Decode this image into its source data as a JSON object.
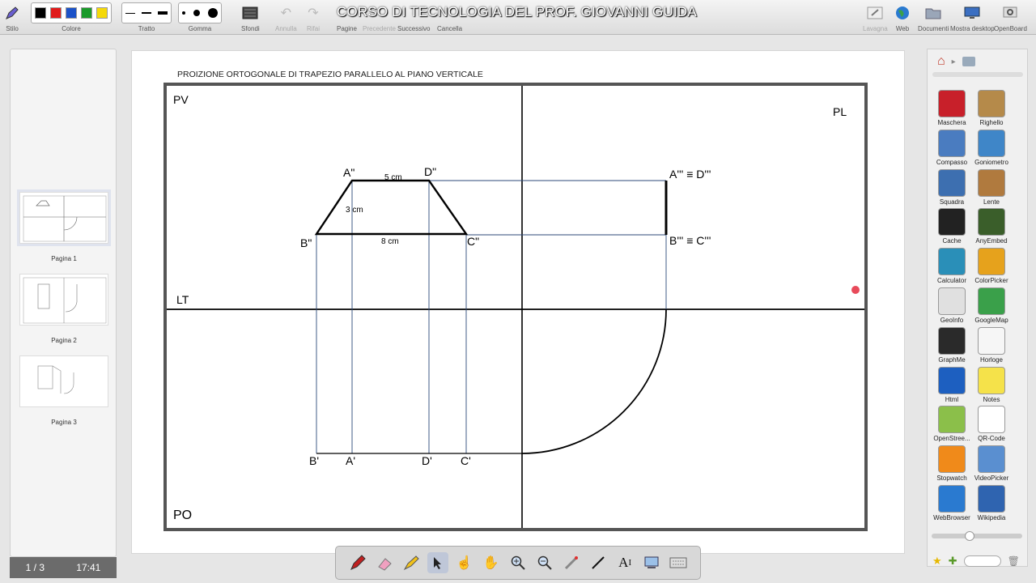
{
  "window_title": "CORSO DI TECNOLOGIA DEL PROF. GIOVANNI GUIDA",
  "toolbar": {
    "stilo": "Stilo",
    "colore": "Colore",
    "tratto": "Tratto",
    "gomma": "Gomma",
    "sfondi": "Sfondi",
    "annulla": "Annulla",
    "rifai": "Rifai",
    "pagine": "Pagine",
    "precedente": "Precedente",
    "successivo": "Successivo",
    "cancella": "Cancella",
    "lavagna": "Lavagna",
    "web": "Web",
    "documenti": "Documenti",
    "mostra_desktop": "Mostra desktop",
    "openboard": "OpenBoard",
    "colors": [
      "#000000",
      "#e01b1b",
      "#1b52c8",
      "#1a9a2a",
      "#f5d90a"
    ]
  },
  "pages": [
    {
      "label": "Pagina 1"
    },
    {
      "label": "Pagina 2"
    },
    {
      "label": "Pagina 3"
    }
  ],
  "status": {
    "page_counter": "1 / 3",
    "time": "17:41"
  },
  "drawing": {
    "title": "PROIZIONE ORTOGONALE DI TRAPEZIO PARALLELO AL PIANO VERTICALE",
    "pv": "PV",
    "pl": "PL",
    "lt": "LT",
    "po": "PO",
    "a2": "A\"",
    "d2": "D\"",
    "b2": "B\"",
    "c2": "C\"",
    "a3d3": "A''' ≡ D'''",
    "b3c3": "B''' ≡ C'''",
    "top_dim": "5 cm",
    "height_dim": "3 cm",
    "base_dim": "8 cm",
    "b1": "B'",
    "a1": "A'",
    "d1": "D'",
    "c1": "C'"
  },
  "apps": [
    {
      "label": "Maschera",
      "color": "#c8202a"
    },
    {
      "label": "Righello",
      "color": "#b58a4a"
    },
    {
      "label": "Compasso",
      "color": "#4a7cc0"
    },
    {
      "label": "Goniometro",
      "color": "#3f86c8"
    },
    {
      "label": "Squadra",
      "color": "#3d6fb0"
    },
    {
      "label": "Lente",
      "color": "#b07a3e"
    },
    {
      "label": "Cache",
      "color": "#222222"
    },
    {
      "label": "AnyEmbed",
      "color": "#3a5e2a"
    },
    {
      "label": "Calculator",
      "color": "#2a8fb8"
    },
    {
      "label": "ColorPicker",
      "color": "#e6a21c"
    },
    {
      "label": "GeoInfo",
      "color": "#e0e0e0"
    },
    {
      "label": "GoogleMap",
      "color": "#3aa04a"
    },
    {
      "label": "GraphMe",
      "color": "#2a2a2a"
    },
    {
      "label": "Horloge",
      "color": "#f6f6f6"
    },
    {
      "label": "Html",
      "color": "#1d5fc0"
    },
    {
      "label": "Notes",
      "color": "#f5e24a"
    },
    {
      "label": "OpenStree...",
      "color": "#8bbf4a"
    },
    {
      "label": "QR-Code",
      "color": "#ffffff"
    },
    {
      "label": "Stopwatch",
      "color": "#f08a1a"
    },
    {
      "label": "VideoPicker",
      "color": "#5a8fd0"
    },
    {
      "label": "WebBrowser",
      "color": "#2a7ad0"
    },
    {
      "label": "Wikipedia",
      "color": "#2f64b0"
    }
  ],
  "dock_tools": [
    "pen-tool",
    "eraser-tool",
    "marker-tool",
    "selector-tool",
    "interact-tool",
    "hand-tool",
    "zoom-in-tool",
    "zoom-out-tool",
    "laser-tool",
    "line-tool",
    "text-tool",
    "capture-tool",
    "keyboard-tool"
  ]
}
